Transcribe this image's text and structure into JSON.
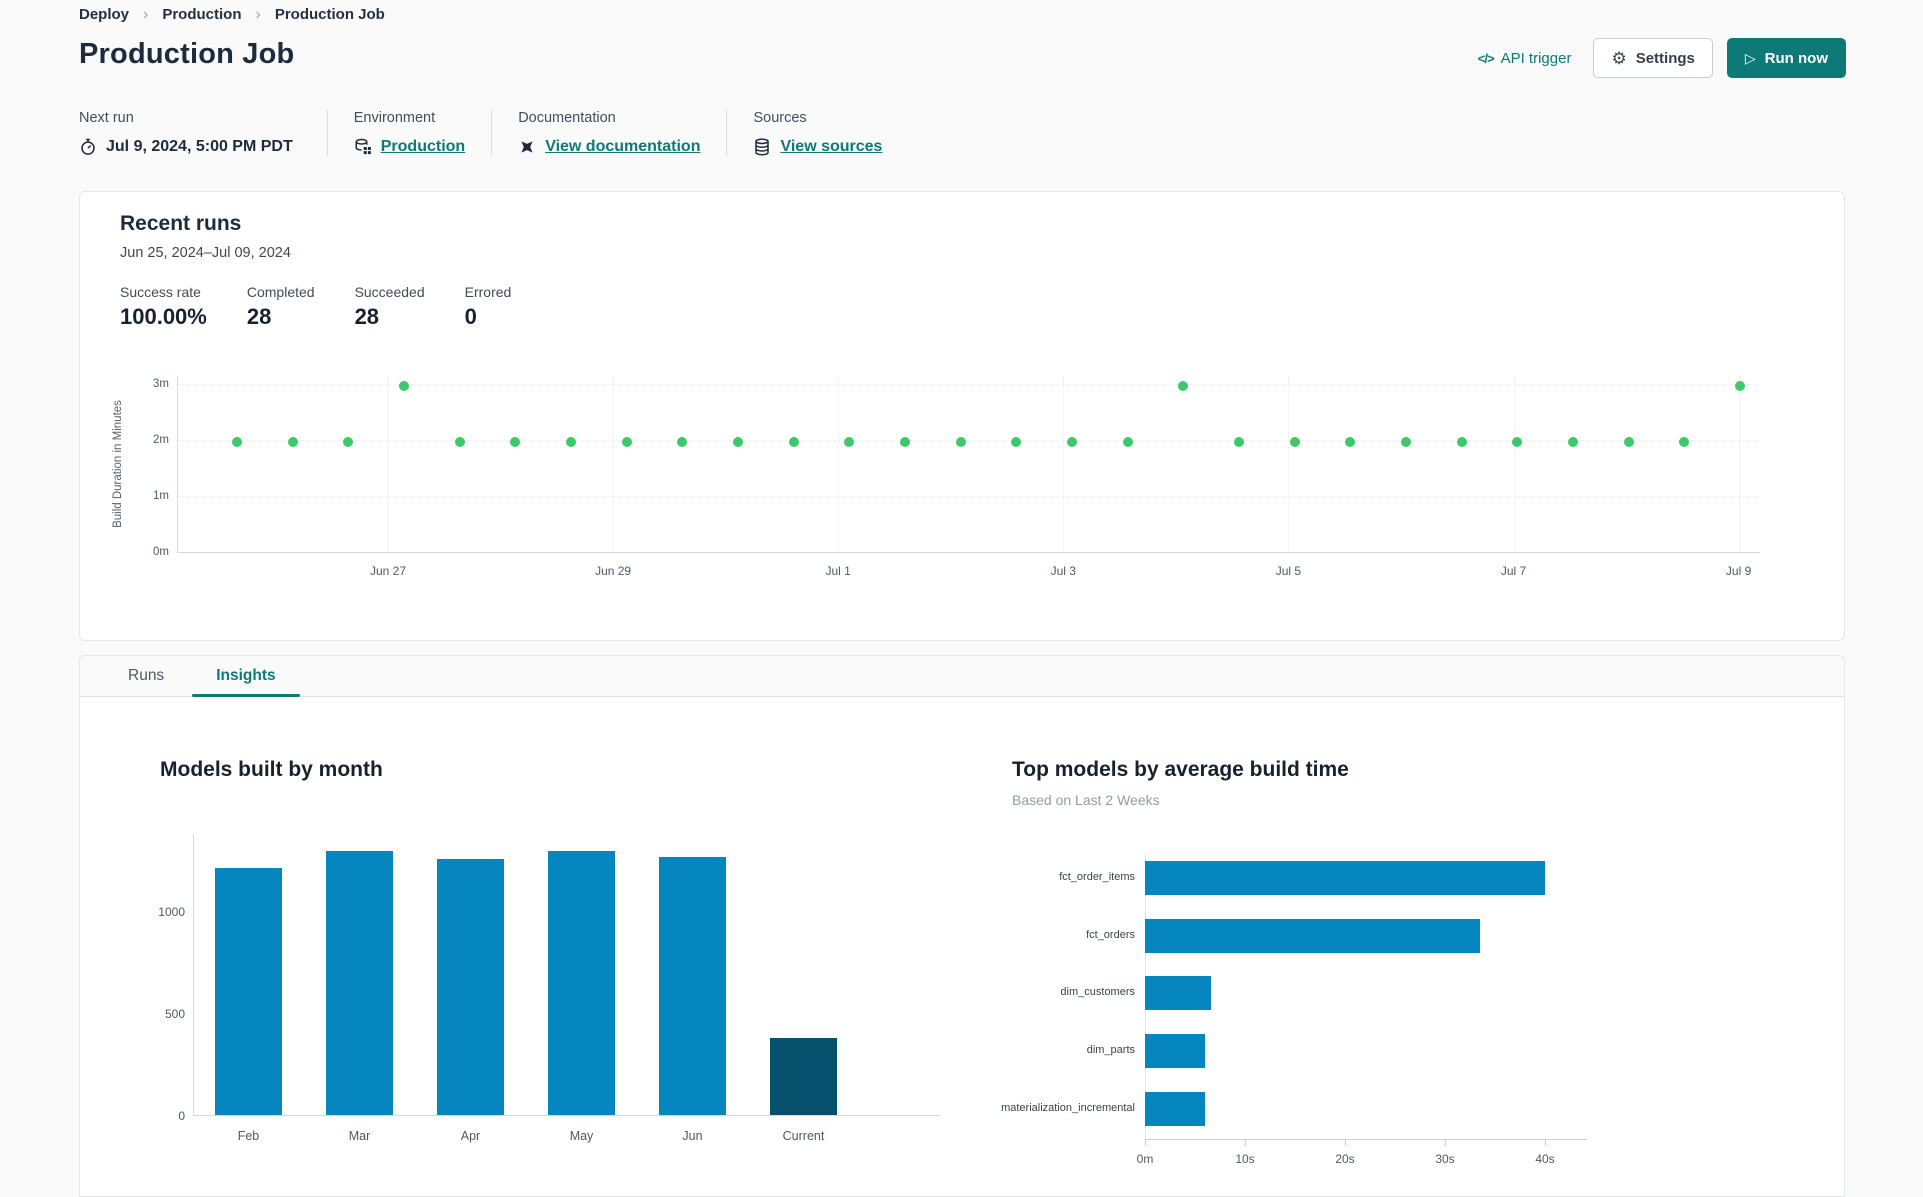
{
  "breadcrumb": {
    "items": [
      "Deploy",
      "Production",
      "Production Job"
    ]
  },
  "icons": {
    "separator": "›",
    "code": "</>",
    "gear": "⚙",
    "play": "▷"
  },
  "header": {
    "title": "Production Job",
    "api_trigger_label": "API trigger",
    "settings_label": "Settings",
    "run_now_label": "Run now"
  },
  "meta": {
    "next_run": {
      "label": "Next run",
      "value": "Jul 9, 2024, 5:00 PM PDT"
    },
    "environment": {
      "label": "Environment",
      "value": "Production"
    },
    "documentation": {
      "label": "Documentation",
      "value": "View documentation"
    },
    "sources": {
      "label": "Sources",
      "value": "View sources"
    }
  },
  "recent_runs": {
    "title": "Recent runs",
    "date_range": "Jun 25, 2024–Jul 09, 2024",
    "stats": [
      {
        "label": "Success rate",
        "value": "100.00%"
      },
      {
        "label": "Completed",
        "value": "28"
      },
      {
        "label": "Succeeded",
        "value": "28"
      },
      {
        "label": "Errored",
        "value": "0"
      }
    ]
  },
  "tabs": [
    {
      "label": "Runs",
      "active": false
    },
    {
      "label": "Insights",
      "active": true
    }
  ],
  "colors": {
    "accent_teal": "#0e7a77",
    "dot_green": "#3ec968",
    "bar_blue": "#0686be",
    "bar_navy": "#07506e",
    "page_bg": "#fafafa",
    "card_border": "#e5e8ea"
  },
  "chart_data": [
    {
      "id": "run_durations",
      "type": "scatter",
      "ylabel": "Build Duration in Minutes",
      "yticks": [
        "0m",
        "1m",
        "2m",
        "3m"
      ],
      "ylim": [
        0,
        3.2
      ],
      "xticklabels": [
        "Jun 27",
        "Jun 29",
        "Jul 1",
        "Jul 3",
        "Jul 5",
        "Jul 7",
        "Jul 9"
      ],
      "values_minutes": [
        1.97,
        1.97,
        1.97,
        2.97,
        1.97,
        1.97,
        1.97,
        1.97,
        1.97,
        1.97,
        1.97,
        1.97,
        1.97,
        1.97,
        1.97,
        1.97,
        1.97,
        2.97,
        1.97,
        1.97,
        1.97,
        1.97,
        1.97,
        1.97,
        1.97,
        1.97,
        1.97,
        2.97
      ],
      "point_color": "#3ec968",
      "grid": true,
      "legend": "none"
    },
    {
      "id": "models_built_by_month",
      "type": "bar",
      "title": "Models built by month",
      "categories": [
        "Feb",
        "Mar",
        "Apr",
        "May",
        "Jun",
        "Current"
      ],
      "values": [
        1210,
        1295,
        1255,
        1295,
        1265,
        375
      ],
      "bar_colors": [
        "#0686be",
        "#0686be",
        "#0686be",
        "#0686be",
        "#0686be",
        "#07506e"
      ],
      "yticks": [
        0,
        500,
        1000
      ],
      "ylim": [
        0,
        1370
      ],
      "xlabel": "",
      "ylabel": ""
    },
    {
      "id": "top_models_by_build_time",
      "type": "bar-horizontal",
      "title": "Top models by average build time",
      "subtitle": "Based on Last 2 Weeks",
      "categories": [
        "fct_order_items",
        "fct_orders",
        "dim_customers",
        "dim_parts",
        "materialization_incremental"
      ],
      "values_seconds": [
        40,
        33.5,
        6.6,
        6,
        6
      ],
      "bar_color": "#0686be",
      "xticks": [
        "0m",
        "10s",
        "20s",
        "30s",
        "40s"
      ],
      "xtick_seconds": [
        0,
        10,
        20,
        30,
        40
      ],
      "xlim": [
        0,
        44
      ]
    }
  ]
}
